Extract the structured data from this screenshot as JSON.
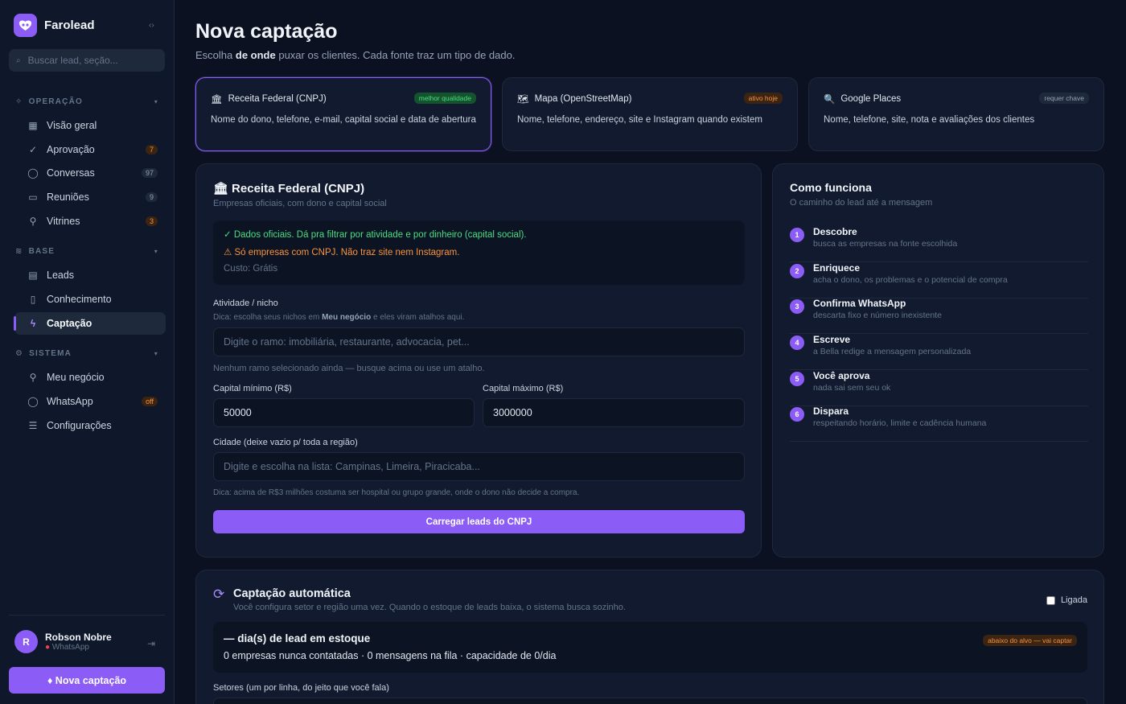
{
  "sidebar": {
    "brand": "Farolead",
    "search_placeholder": "Buscar lead, seção...",
    "sections": {
      "operacao": "OPERAÇÃO",
      "base": "BASE",
      "sistema": "SISTEMA"
    },
    "items": {
      "visao_geral": "Visão geral",
      "aprovacao": "Aprovação",
      "aprovacao_badge": "7",
      "conversas": "Conversas",
      "conversas_badge": "97",
      "reunioes": "Reuniões",
      "reunioes_badge": "9",
      "vitrines": "Vitrines",
      "vitrines_badge": "3",
      "leads": "Leads",
      "conhecimento": "Conhecimento",
      "captacao": "Captação",
      "meu_negocio": "Meu negócio",
      "whatsapp": "WhatsApp",
      "whatsapp_badge": "off",
      "configuracoes": "Configurações"
    },
    "user": {
      "initial": "R",
      "name": "Robson Nobre",
      "status": "WhatsApp"
    },
    "nova_button": "♦ Nova captação"
  },
  "page": {
    "title": "Nova captação",
    "subtitle_pre": "Escolha",
    "subtitle_bold": "de onde",
    "subtitle_post": "puxar os clientes. Cada fonte traz um tipo de dado."
  },
  "sources": [
    {
      "icon": "🏛",
      "name": "Receita Federal (CNPJ)",
      "tag": "melhor qualidade",
      "desc": "Nome do dono, telefone, e-mail, capital social e data de abertura"
    },
    {
      "icon": "🗺",
      "name": "Mapa (OpenStreetMap)",
      "tag": "ativo hoje",
      "desc": "Nome, telefone, endereço, site e Instagram quando existem"
    },
    {
      "icon": "🔍",
      "name": "Google Places",
      "tag": "requer chave",
      "desc": "Nome, telefone, site, nota e avaliações dos clientes"
    }
  ],
  "form": {
    "title": "Receita Federal (CNPJ)",
    "subtitle": "Empresas oficiais, com dono e capital social",
    "info_ok": "✓ Dados oficiais. Dá pra filtrar por atividade e por dinheiro (capital social).",
    "info_warn": "⚠ Só empresas com CNPJ. Não traz site nem Instagram.",
    "info_cost": "Custo: Grátis",
    "atividade_label": "Atividade / nicho",
    "atividade_hint_pre": "Dica: escolha seus nichos em",
    "atividade_hint_bold": "Meu negócio",
    "atividade_hint_post": "e eles viram atalhos aqui.",
    "atividade_placeholder": "Digite o ramo: imobiliária, restaurante, advocacia, pet...",
    "atividade_empty": "Nenhum ramo selecionado ainda — busque acima ou use um atalho.",
    "cap_min_label": "Capital mínimo (R$)",
    "cap_min_value": "50000",
    "cap_max_label": "Capital máximo (R$)",
    "cap_max_value": "3000000",
    "cidade_label": "Cidade (deixe vazio p/ toda a região)",
    "cidade_placeholder": "Digite e escolha na lista: Campinas, Limeira, Piracicaba...",
    "cidade_hint": "Dica: acima de R$3 milhões costuma ser hospital ou grupo grande, onde o dono não decide a compra.",
    "submit": "Carregar leads do CNPJ"
  },
  "how": {
    "title": "Como funciona",
    "subtitle": "O caminho do lead até a mensagem",
    "steps": [
      {
        "n": "1",
        "title": "Descobre",
        "desc": "busca as empresas na fonte escolhida"
      },
      {
        "n": "2",
        "title": "Enriquece",
        "desc": "acha o dono, os problemas e o potencial de compra"
      },
      {
        "n": "3",
        "title": "Confirma WhatsApp",
        "desc": "descarta fixo e número inexistente"
      },
      {
        "n": "4",
        "title": "Escreve",
        "desc": "a Bella redige a mensagem personalizada"
      },
      {
        "n": "5",
        "title": "Você aprova",
        "desc": "nada sai sem seu ok"
      },
      {
        "n": "6",
        "title": "Dispara",
        "desc": "respeitando horário, limite e cadência humana"
      }
    ]
  },
  "auto": {
    "title": "Captação automática",
    "subtitle": "Você configura setor e região uma vez. Quando o estoque de leads baixa, o sistema busca sozinho.",
    "toggle_label": "Ligada",
    "stock_title": "— dia(s) de lead em estoque",
    "stock_desc": "0 empresas nunca contatadas · 0 mensagens na fila · capacidade de 0/dia",
    "stock_tag": "abaixo do alvo — vai captar",
    "setores_label": "Setores (um por linha, do jeito que você fala)"
  }
}
